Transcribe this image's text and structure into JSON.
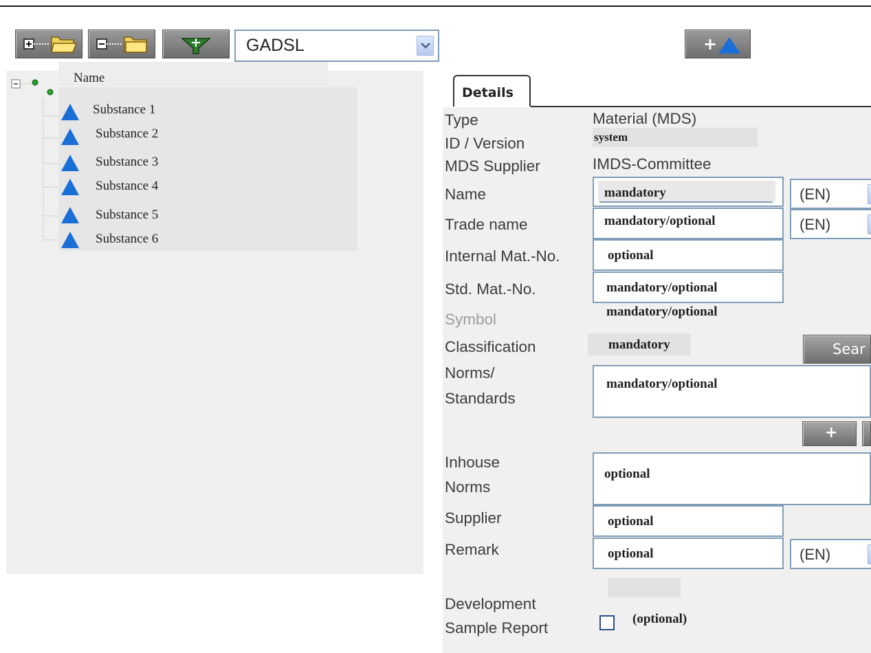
{
  "toolbar": {
    "filter_select_value": "GADSL",
    "add_button_label": "+"
  },
  "tree": {
    "header": "Name",
    "items": [
      {
        "label": "Substance 1"
      },
      {
        "label": "Substance 2"
      },
      {
        "label": "Substance 3"
      },
      {
        "label": "Substance 4"
      },
      {
        "label": "Substance 5"
      },
      {
        "label": "Substance 6"
      }
    ]
  },
  "details": {
    "tab_label": "Details",
    "type": {
      "label": "Type",
      "value": "Material (MDS)"
    },
    "id_version": {
      "label": "ID / Version",
      "value": "system"
    },
    "mds_supplier": {
      "label": "MDS Supplier",
      "value": "IMDS-Committee"
    },
    "name": {
      "label": "Name",
      "value": "mandatory",
      "lang": "(EN)"
    },
    "trade_name": {
      "label": "Trade name",
      "value": "mandatory/optional",
      "lang": "(EN)"
    },
    "internal_mat_no": {
      "label": "Internal Mat.-No.",
      "value": "optional"
    },
    "std_mat_no": {
      "label": "Std. Mat.-No.",
      "value": "mandatory/optional"
    },
    "symbol": {
      "label": "Symbol",
      "value": "mandatory/optional"
    },
    "classification": {
      "label": "Classification",
      "value": "mandatory",
      "search_button": "Sear"
    },
    "norms_standards": {
      "label_line1": "Norms/",
      "label_line2": "Standards",
      "value": "mandatory/optional"
    },
    "norms_add_button": "+",
    "inhouse_norms": {
      "label_line1": "Inhouse",
      "label_line2": "Norms",
      "value": "optional"
    },
    "supplier": {
      "label": "Supplier",
      "value": "optional"
    },
    "remark": {
      "label": "Remark",
      "value": "optional",
      "lang": "(EN)"
    },
    "development_sample_report": {
      "label_line1": "Development",
      "label_line2": "Sample Report",
      "value": "(optional)",
      "checked": false
    }
  },
  "colors": {
    "field_border": "#7f9db9",
    "substance_icon": "#1a6fd6",
    "button_gray": "#8a8a8a"
  }
}
